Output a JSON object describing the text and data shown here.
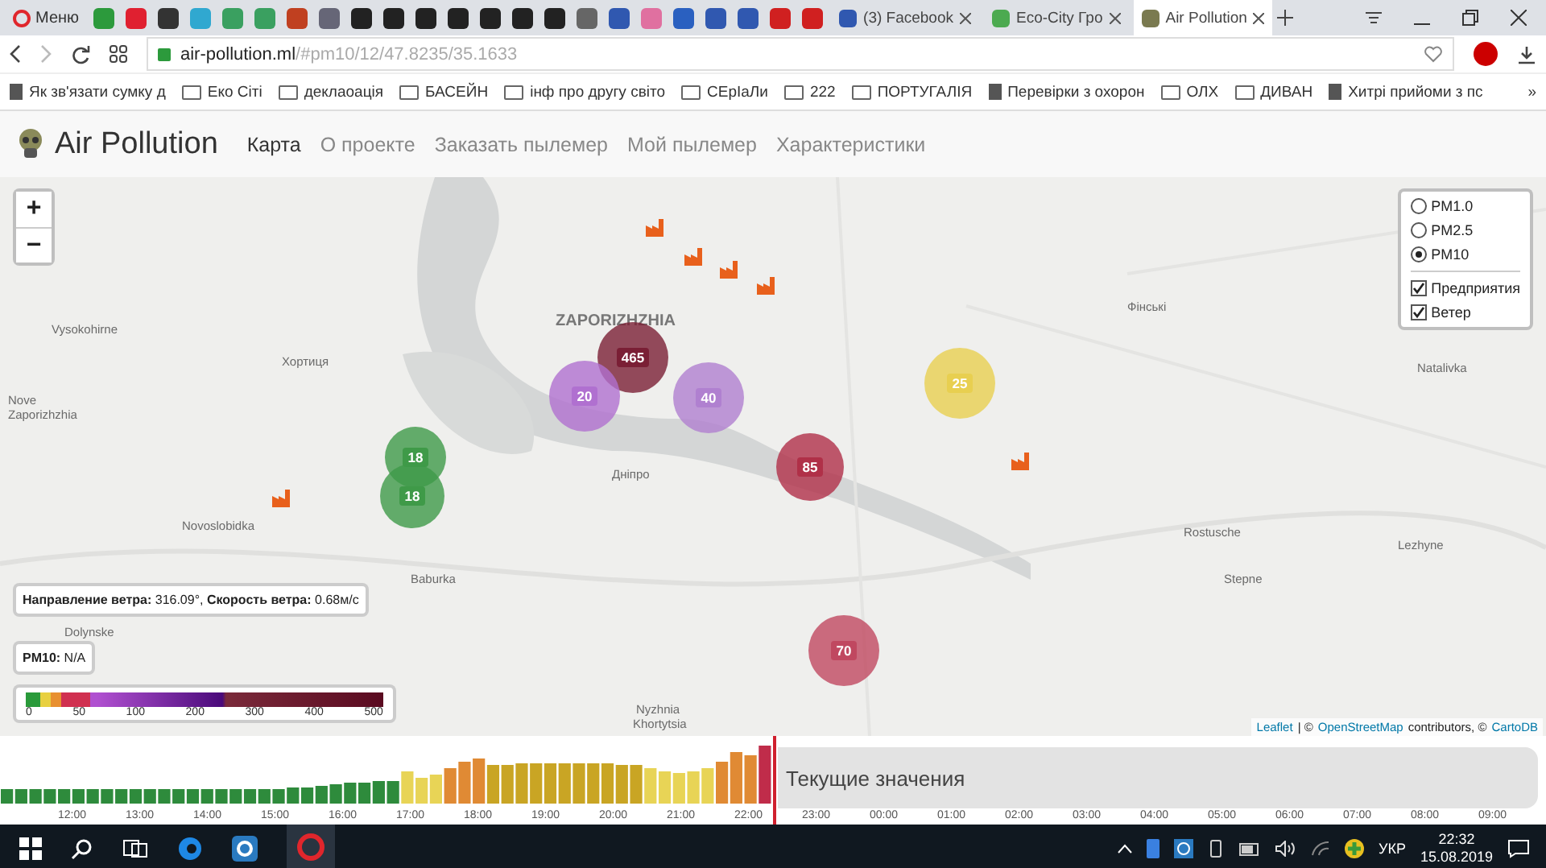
{
  "browser": {
    "menu_label": "Меню",
    "tabs": [
      {
        "label": "(3) Facebook",
        "selected": false
      },
      {
        "label": "Eco-City Гро",
        "selected": false
      },
      {
        "label": "Air Pollution",
        "selected": true
      }
    ],
    "address": {
      "domain": "air-pollution.ml",
      "path": "/#pm10/12/47.8235/35.1633"
    },
    "bookmarks": [
      {
        "label": "Як зв'язати сумку д",
        "kind": "page"
      },
      {
        "label": "Еко Сіті",
        "kind": "folder"
      },
      {
        "label": "деклаоація",
        "kind": "folder"
      },
      {
        "label": "БАСЕЙН",
        "kind": "folder"
      },
      {
        "label": "інф про другу світо",
        "kind": "folder"
      },
      {
        "label": "CEpIaЛи",
        "kind": "folder"
      },
      {
        "label": "222",
        "kind": "folder"
      },
      {
        "label": "ПОРТУГАЛІЯ",
        "kind": "folder"
      },
      {
        "label": "Перевірки з охорон",
        "kind": "page"
      },
      {
        "label": "ОЛХ",
        "kind": "folder"
      },
      {
        "label": "ДИВАН",
        "kind": "folder"
      },
      {
        "label": "Хитрі прийоми з пс",
        "kind": "page"
      }
    ],
    "more": "»"
  },
  "app": {
    "brand": "Air Pollution",
    "nav": [
      {
        "label": "Карта",
        "selected": true
      },
      {
        "label": "О проекте",
        "selected": false
      },
      {
        "label": "Заказать пылемер",
        "selected": false
      },
      {
        "label": "Мой пылемер",
        "selected": false
      },
      {
        "label": "Характеристики",
        "selected": false
      }
    ]
  },
  "map": {
    "zoom_in": "+",
    "zoom_out": "−",
    "labels": [
      "Vysokohirne",
      "Хортиця",
      "Nove",
      "Zaporizhzhia",
      "ZAPORIZHZHIA",
      "Фінські",
      "Natalivka",
      "Дніпро",
      "Novoslobidka",
      "Rostusche",
      "Lezhyne",
      "Baburka",
      "Stepne",
      "Dolynske",
      "Nyzhnia",
      "Khortytsia"
    ],
    "markers": [
      {
        "value": "465",
        "color": "#7a1f35"
      },
      {
        "value": "20",
        "color": "#b070d0"
      },
      {
        "value": "40",
        "color": "#b080d0"
      },
      {
        "value": "25",
        "color": "#e8cf50"
      },
      {
        "value": "85",
        "color": "#b03048"
      },
      {
        "value": "18",
        "color": "#3f9a48"
      },
      {
        "value": "18",
        "color": "#3f9a48"
      },
      {
        "value": "70",
        "color": "#c04860"
      }
    ],
    "layers": {
      "radios": [
        {
          "label": "PM1.0",
          "selected": false
        },
        {
          "label": "PM2.5",
          "selected": false
        },
        {
          "label": "PM10",
          "selected": true
        }
      ],
      "checkboxes": [
        {
          "label": "Предприятия",
          "checked": true
        },
        {
          "label": "Ветер",
          "checked": true
        }
      ]
    },
    "wind_info": "**Направление ветра:** 316.09°, **Скорость ветра:** 0.68м/с",
    "pm_info": "**PM10:** N/A",
    "scale_ticks": [
      "0",
      "50",
      "100",
      "200",
      "300",
      "400",
      "500"
    ],
    "attribution": [
      {
        "text": "Leaflet",
        "link": true
      },
      {
        "text": "| ©",
        "link": false
      },
      {
        "text": "OpenStreetMap",
        "link": true
      },
      {
        "text": "contributors, ©",
        "link": false
      },
      {
        "text": "CartoDB",
        "link": true
      }
    ]
  },
  "timeline": {
    "current_label": "Текущие значения",
    "hours": [
      "12:00",
      "13:00",
      "14:00",
      "15:00",
      "16:00",
      "17:00",
      "18:00",
      "19:00",
      "20:00",
      "21:00",
      "22:00",
      "23:00",
      "00:00",
      "01:00",
      "02:00",
      "03:00",
      "04:00",
      "05:00",
      "06:00",
      "07:00",
      "08:00",
      "09:00"
    ]
  },
  "taskbar": {
    "language": "УКР",
    "time": "22:32",
    "date": "15.08.2019"
  }
}
